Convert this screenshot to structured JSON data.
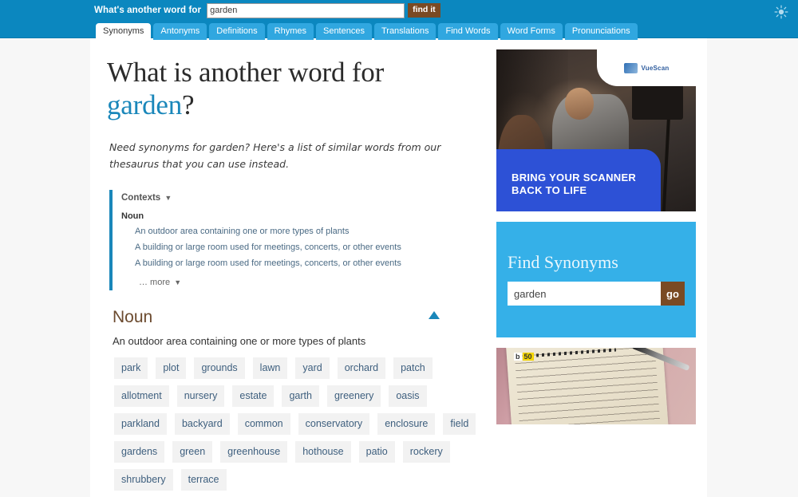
{
  "header": {
    "search_label": "What's another word for",
    "search_value": "garden",
    "search_placeholder": "",
    "find_button": "find it",
    "theme_toggle_icon": "sun-icon"
  },
  "tabs": [
    {
      "label": "Synonyms",
      "active": true
    },
    {
      "label": "Antonyms",
      "active": false
    },
    {
      "label": "Definitions",
      "active": false
    },
    {
      "label": "Rhymes",
      "active": false
    },
    {
      "label": "Sentences",
      "active": false
    },
    {
      "label": "Translations",
      "active": false
    },
    {
      "label": "Find Words",
      "active": false
    },
    {
      "label": "Word Forms",
      "active": false
    },
    {
      "label": "Pronunciations",
      "active": false
    }
  ],
  "main": {
    "title_prefix": "What is another word for",
    "title_term": "garden",
    "title_suffix": "?",
    "lead": "Need synonyms for garden? Here's a list of similar words from our thesaurus that you can use instead.",
    "contexts": {
      "title": "Contexts",
      "caret": "▼",
      "pos": "Noun",
      "items": [
        "An outdoor area containing one or more types of plants",
        "A building or large room used for meetings, concerts, or other events",
        "A building or large room used for meetings, concerts, or other events"
      ],
      "more_label": "… more",
      "more_caret": "▼"
    },
    "sense": {
      "pos": "Noun",
      "definition": "An outdoor area containing one or more types of plants",
      "synonyms": [
        "park",
        "plot",
        "grounds",
        "lawn",
        "yard",
        "orchard",
        "patch",
        "allotment",
        "nursery",
        "estate",
        "garth",
        "greenery",
        "oasis",
        "parkland",
        "backyard",
        "common",
        "conservatory",
        "enclosure",
        "field",
        "gardens",
        "green",
        "greenhouse",
        "hothouse",
        "patio",
        "rockery",
        "shrubbery",
        "terrace"
      ]
    }
  },
  "sidebar": {
    "ad": {
      "brand": "VueScan",
      "tagline_line1": "BRING YOUR SCANNER",
      "tagline_line2": "BACK TO LIFE"
    },
    "find_widget": {
      "title": "Find Synonyms",
      "input_value": "garden",
      "input_placeholder": "",
      "button_label": "go"
    },
    "note_photo": {
      "badge_first": "b",
      "badge_second": "50"
    }
  },
  "colors": {
    "header_blue": "#0b87bf",
    "tab_blue": "#30a7e0",
    "accent_blue": "#1a87ba",
    "widget_blue": "#35b0e8",
    "button_brown": "#7a4a23",
    "chip_bg": "#f2f2f2",
    "chip_text": "#3e5f7e",
    "pos_brown": "#6b4a2e"
  }
}
